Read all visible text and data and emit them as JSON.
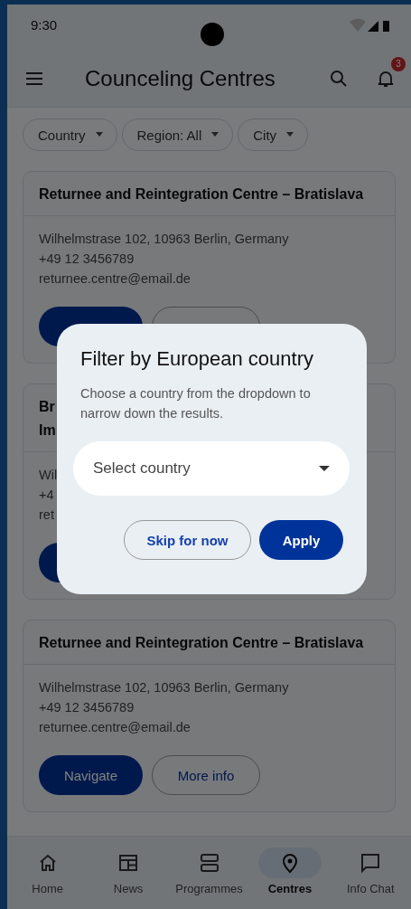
{
  "status_bar": {
    "time": "9:30"
  },
  "app_bar": {
    "title": "Counceling Centres",
    "notification_count": "3"
  },
  "filters": [
    {
      "label": "Country"
    },
    {
      "label": "Region: All"
    },
    {
      "label": "City"
    }
  ],
  "cards": [
    {
      "title_lines": [
        "Returnee and Reintegration Centre – Bratislava"
      ],
      "lines": [
        "Wilhelmstrase 102, 10963 Berlin, Germany",
        "+49 12 3456789",
        "returnee.centre@email.de"
      ],
      "actions": [
        {
          "kind": "filled"
        },
        {
          "kind": "outlined"
        }
      ]
    },
    {
      "title_lines": [
        "Br",
        "Im"
      ],
      "lines": [
        "Wil",
        "+4",
        "ret"
      ],
      "actions": [
        {
          "kind": "filled"
        }
      ]
    },
    {
      "title_lines": [
        "Returnee and Reintegration Centre – Bratislava"
      ],
      "lines": [
        "Wilhelmstrase 102, 10963 Berlin, Germany",
        "+49 12 3456789",
        "returnee.centre@email.de"
      ],
      "actions": [
        {
          "kind": "filled",
          "label": "Navigate"
        },
        {
          "kind": "outlined",
          "label": "More info"
        }
      ]
    }
  ],
  "dialog": {
    "title": "Filter by European country",
    "text": "Choose a country from the dropdown to narrow down the results.",
    "select": {
      "placeholder": "Select country"
    },
    "buttons": [
      {
        "kind": "outlined",
        "label": "Skip for now"
      },
      {
        "kind": "filled",
        "label": "Apply"
      }
    ]
  },
  "bottom_nav": [
    {
      "label": "Home",
      "selected": false
    },
    {
      "label": "News",
      "selected": false
    },
    {
      "label": "Programmes",
      "selected": false
    },
    {
      "label": "Centres",
      "selected": true
    },
    {
      "label": "Info Chat",
      "selected": false
    }
  ]
}
